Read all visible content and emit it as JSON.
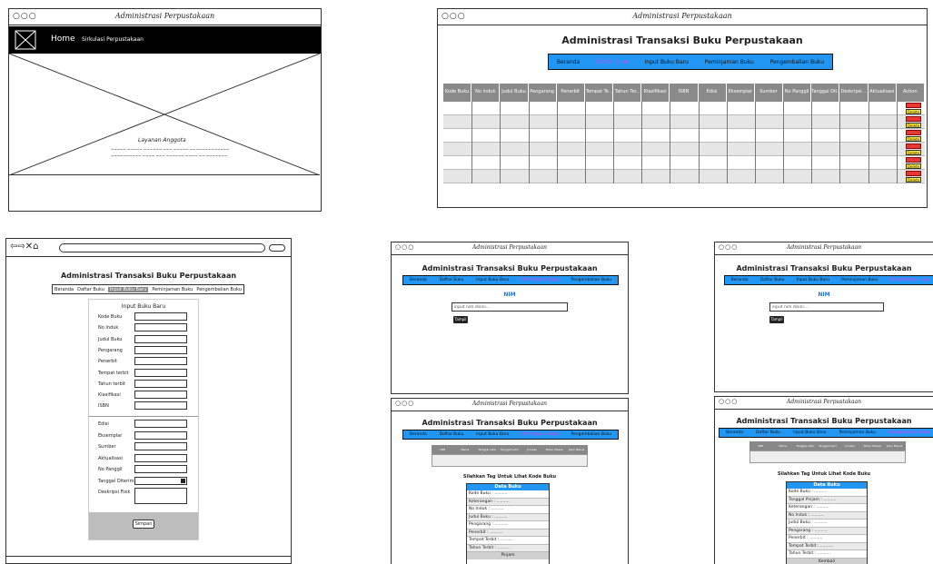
{
  "home": {
    "window_title": "Administrasi Perpustakaan",
    "nav_home": "Home",
    "nav_sirkulasi": "Sirkulasi Perpustakaan",
    "layanan_title": "Layanan Anggota",
    "layanan_line1": "~~~~~ ~~~~~ ~~~~~~ ~~~ ~~~~~ ~~~~~~~~~~~~~",
    "layanan_line2": "~~~~~~~~~~ ~~~~ ~~~ ~~~~~~ ~~~~ ~~ ~~~~~~~"
  },
  "daftar": {
    "window_title": "Administrasi Perpustakaan",
    "heading": "Administrasi Transaksi Buku Perpustakaan",
    "nav": [
      "Beranda",
      "Daftar Buku",
      "Input Buku Baru",
      "Peminjaman Buku",
      "Pengembalian Buku"
    ],
    "active_index": 1,
    "columns": [
      "Kode Buku",
      "No induk",
      "Judul Buku",
      "Pengarang",
      "Penerbit",
      "Tempat Te..",
      "Tahun Ter..",
      "Klasifikasi",
      "ISBN",
      "Edisi",
      "Eksemplar",
      "Sumber",
      "No Panggil",
      "Tanggal Dit..",
      "Deskripsi ..",
      "Aktualisasi",
      "Action"
    ],
    "edit_label": "Edit",
    "delete_label": "Delete",
    "row_count": 6
  },
  "input": {
    "heading": "Administrasi Transaksi Buku Perpustakaan",
    "nav": [
      "Beranda",
      "Daftar Buku",
      "Input Buku Baru",
      "Peminjaman Buku",
      "Pengembalian Buku"
    ],
    "active_index": 2,
    "form_title": "Input Buku Baru",
    "fields_top": [
      "Kode Buku",
      "No Induk",
      "Judul Buku",
      "Pengarang",
      "Penerbit",
      "Tempat terbit",
      "Tahun terbit",
      "Klasifikasi",
      "ISBN"
    ],
    "fields_bottom": [
      "Edisi",
      "Eksemplar",
      "Sumber",
      "Aktualisasi",
      "No Panggil",
      "Tanggal Diterima",
      "Deskripsi Fisik"
    ],
    "save_label": "Simpan"
  },
  "pinjam": {
    "window_title": "Administrasi Perpustakaan",
    "heading": "Administrasi Transaksi Buku Perpustakaan",
    "nav": [
      "Beranda",
      "Daftar Buku",
      "Input Buku Baru",
      "Peminjaman Buku",
      "Pengembalian Buku"
    ],
    "active_index": 3,
    "nim_label": "NIM",
    "placeholder": "input nim disini...",
    "button": "Tampil"
  },
  "kembali": {
    "window_title": "Administrasi Perpustakaan",
    "heading": "Administrasi Transaksi Buku Perpustakaan",
    "nav": [
      "Beranda",
      "Daftar Buku",
      "Input Buku Baru",
      "Peminjaman Buku",
      "Pengembalian Buku"
    ],
    "active_index": 4,
    "nim_label": "NIM",
    "placeholder": "input nim disini...",
    "button": "Tampil"
  },
  "pinjam_detail": {
    "window_title": "Administrasi Perpustakaan",
    "heading": "Administrasi Transaksi Buku Perpustakaan",
    "nav": [
      "Beranda",
      "Daftar Buku",
      "Input Buku Baru",
      "Peminjaman Buku",
      "Pengembalian Buku"
    ],
    "active_index": 3,
    "columns": [
      "NIM",
      "Nama",
      "Tanggal Lahir",
      "Tanggal Lahir",
      "Jurusan",
      "Tahun Masuk",
      "Jalur Masuk"
    ],
    "instruction": "Silahkan Tag Untuk Lihat Kode Buku",
    "panel_title": "Data Buku",
    "panel_rows": [
      "Kode Buku : ..........",
      "Keterangan : ..........",
      "No Induk : ..........",
      "Judul Buku : ..........",
      "Pengarang : ..........",
      "Penerbit : ..........",
      "Tempat Terbit : ..........",
      "Tahun Terbit : .........."
    ],
    "panel_button": "Pinjam"
  },
  "kembali_detail": {
    "window_title": "Administrasi Perpustakaan",
    "heading": "Administrasi Transaksi Buku Perpustakaan",
    "nav": [
      "Beranda",
      "Daftar Buku",
      "Input Buku Baru",
      "Peminjaman Buku",
      "Pengembalian Buku"
    ],
    "active_index": 4,
    "columns": [
      "NIM",
      "Nama",
      "Tanggal Lahir",
      "Tanggal Lahir",
      "Jurusan",
      "Tahun Masuk",
      "Jalur Masuk"
    ],
    "instruction": "Silahkan Tag Untuk Lihat Kode Buku",
    "panel_title": "Data Buku",
    "panel_rows": [
      "Kode Buku : ..........",
      "Tanggal Pinjam : ..........",
      "Keterangan : ..........",
      "No Induk : ..........",
      "Judul Buku : ..........",
      "Pengarang : ..........",
      "Penerbit : ..........",
      "Tempat Terbit : ..........",
      "Tahun Terbit : .........."
    ],
    "panel_button": "Kembali"
  }
}
